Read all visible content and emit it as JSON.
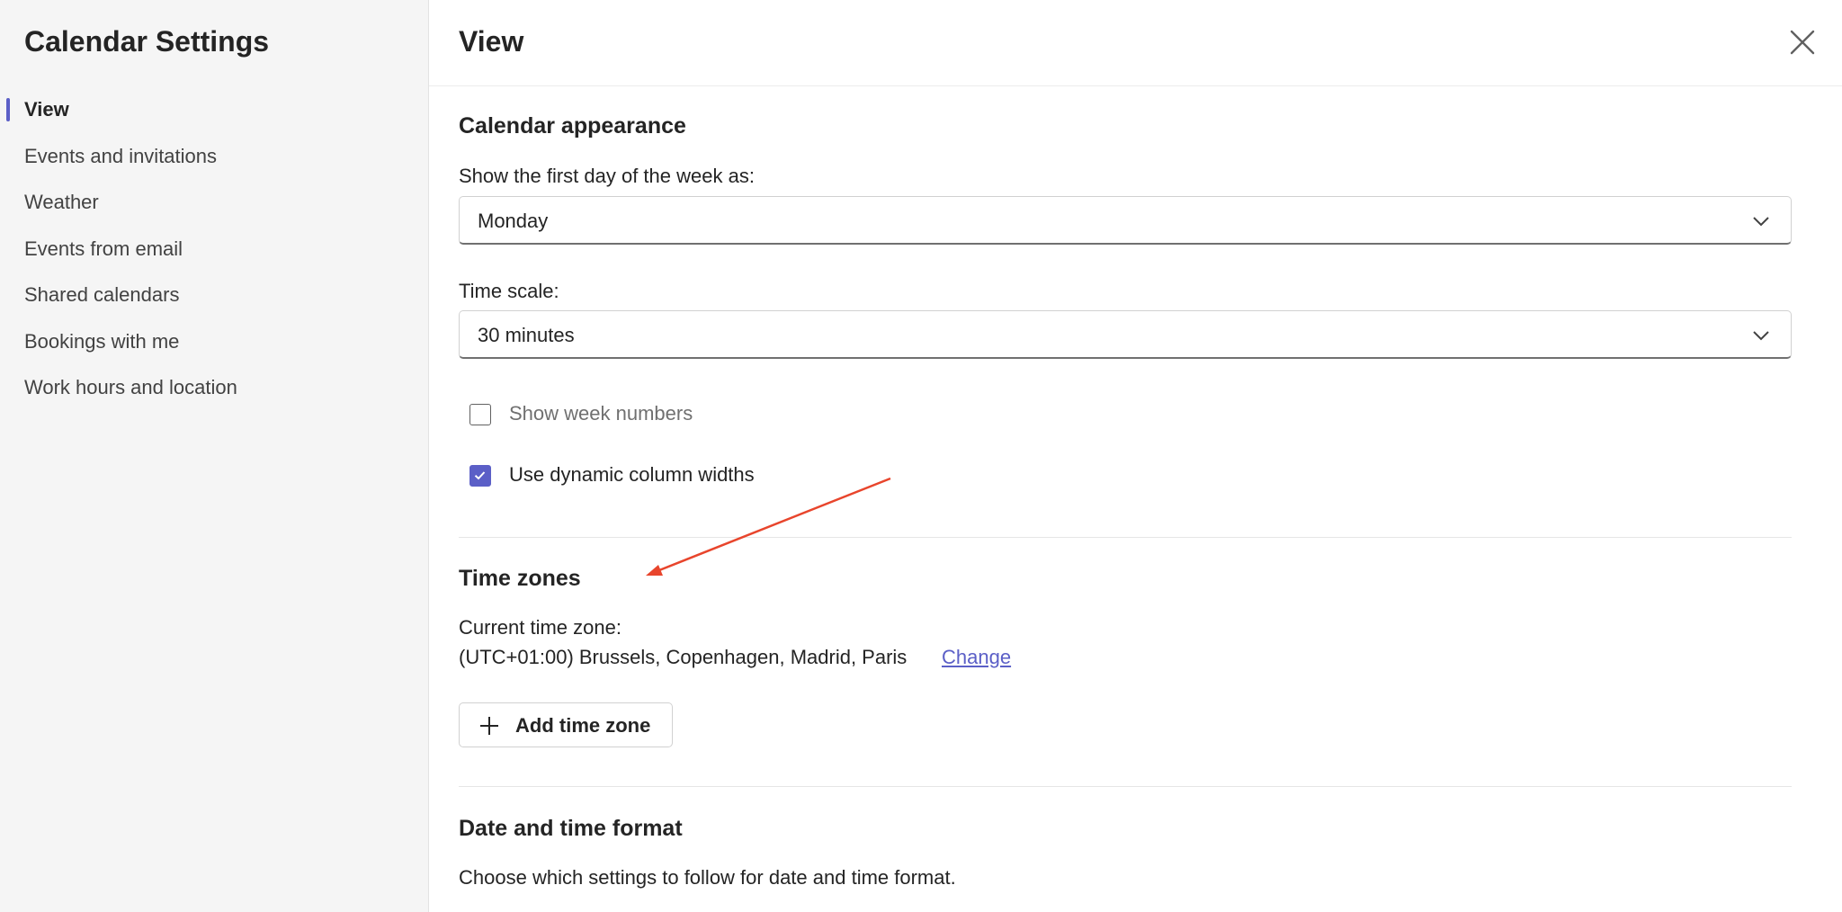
{
  "sidebar": {
    "title": "Calendar Settings",
    "items": [
      {
        "label": "View",
        "active": true
      },
      {
        "label": "Events and invitations"
      },
      {
        "label": "Weather"
      },
      {
        "label": "Events from email"
      },
      {
        "label": "Shared calendars"
      },
      {
        "label": "Bookings with me"
      },
      {
        "label": "Work hours and location"
      }
    ]
  },
  "header": {
    "title": "View",
    "close_icon": "close-icon"
  },
  "appearance": {
    "title": "Calendar appearance",
    "first_day_label": "Show the first day of the week as:",
    "first_day_value": "Monday",
    "time_scale_label": "Time scale:",
    "time_scale_value": "30 minutes",
    "show_week_numbers": {
      "label": "Show week numbers",
      "checked": false
    },
    "dynamic_columns": {
      "label": "Use dynamic column widths",
      "checked": true
    }
  },
  "time_zones": {
    "title": "Time zones",
    "current_label": "Current time zone:",
    "current_value": "(UTC+01:00) Brussels, Copenhagen, Madrid, Paris",
    "change_link": "Change",
    "add_button": "Add time zone"
  },
  "date_time_format": {
    "title": "Date and time format",
    "description": "Choose which settings to follow for date and time format."
  },
  "colors": {
    "accent": "#5b5fc7",
    "annotation_arrow": "#e8452c"
  }
}
